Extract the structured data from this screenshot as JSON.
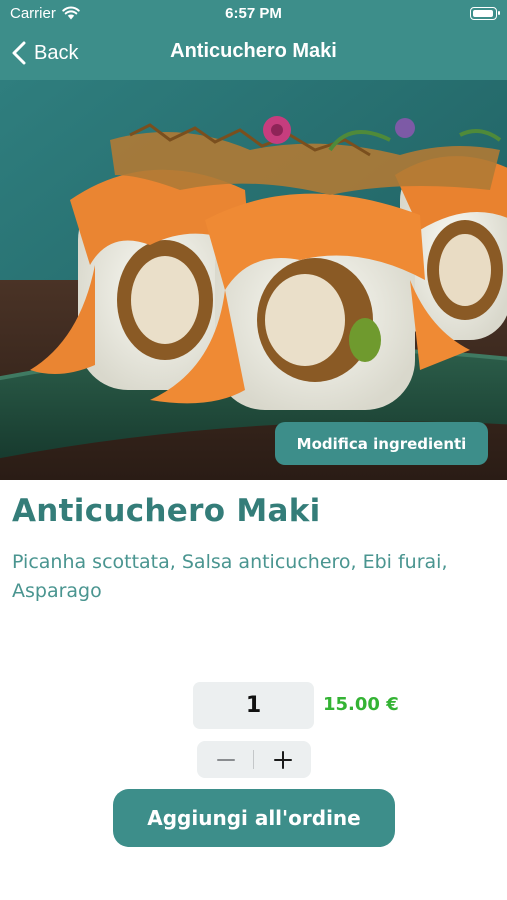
{
  "status_bar": {
    "carrier": "Carrier",
    "time": "6:57 PM"
  },
  "nav": {
    "back_label": "Back",
    "title": "Anticuchero Maki"
  },
  "hero": {
    "image": "sushi-roll-photo",
    "edit_ingredients_label": "Modifica ingredienti"
  },
  "dish": {
    "name": "Anticuchero Maki",
    "description": "Picanha scottata, Salsa anticuchero, Ebi furai, Asparago"
  },
  "order": {
    "quantity": "1",
    "price": "15.00 €",
    "add_to_order_label": "Aggiungi all'ordine"
  },
  "icons": {
    "back": "chevron-left-icon",
    "minus": "minus-icon",
    "plus": "plus-icon",
    "wifi": "wifi-icon",
    "battery": "battery-icon"
  },
  "colors": {
    "primary": "#3d8e8a",
    "title": "#347d79",
    "description": "#4a9590",
    "price": "#34b334",
    "field_bg": "#eceff0"
  }
}
